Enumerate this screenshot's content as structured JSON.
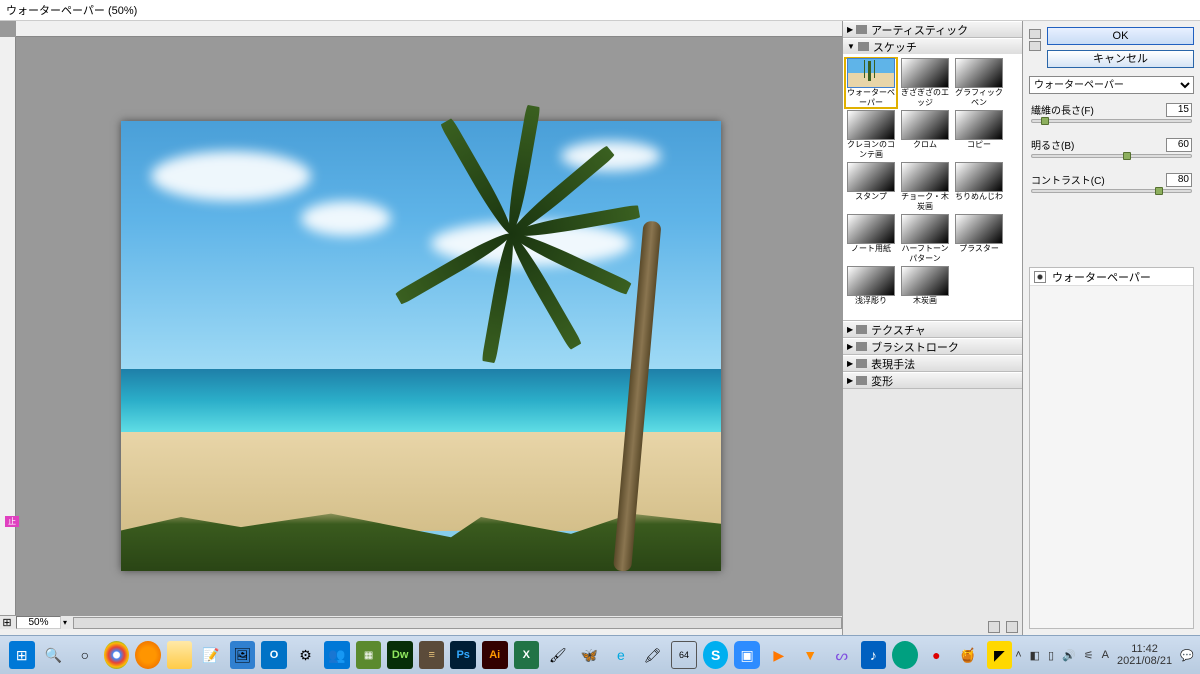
{
  "title": "ウォーターペーパー (50%)",
  "zoom": "50%",
  "stop_badge": "止",
  "buttons": {
    "ok": "OK",
    "cancel": "キャンセル"
  },
  "filter_dropdown": "ウォーターペーパー",
  "sliders": [
    {
      "label": "繊維の長さ(F)",
      "value": 15,
      "pos": 8
    },
    {
      "label": "明るさ(B)",
      "value": 60,
      "pos": 60
    },
    {
      "label": "コントラスト(C)",
      "value": 80,
      "pos": 80
    }
  ],
  "categories": {
    "artistic": "アーティスティック",
    "sketch": "スケッチ",
    "texture": "テクスチャ",
    "brush": "ブラシストローク",
    "express": "表現手法",
    "distort": "変形"
  },
  "thumbs": [
    {
      "label": "ウォーターペーパー",
      "selected": true,
      "style": "thumb-beach thumb-tree"
    },
    {
      "label": "ぎざぎざのエッジ",
      "style": "thumb-bw"
    },
    {
      "label": "グラフィックペン",
      "style": "thumb-bw"
    },
    {
      "label": "クレヨンのコンテ画",
      "style": "thumb-bw"
    },
    {
      "label": "クロム",
      "style": "thumb-bw"
    },
    {
      "label": "コピー",
      "style": "thumb-bw"
    },
    {
      "label": "スタンプ",
      "style": "thumb-bw"
    },
    {
      "label": "チョーク・木炭画",
      "style": "thumb-bw"
    },
    {
      "label": "ちりめんじわ",
      "style": "thumb-bw"
    },
    {
      "label": "ノート用紙",
      "style": "thumb-bw"
    },
    {
      "label": "ハーフトーンパターン",
      "style": "thumb-bw"
    },
    {
      "label": "プラスター",
      "style": "thumb-bw"
    },
    {
      "label": "浅浮彫り",
      "style": "thumb-bw"
    },
    {
      "label": "木炭画",
      "style": "thumb-bw"
    }
  ],
  "layer_name": "ウォーターペーパー",
  "taskbar": {
    "time": "11:42",
    "date": "2021/08/21",
    "lang": "A"
  }
}
